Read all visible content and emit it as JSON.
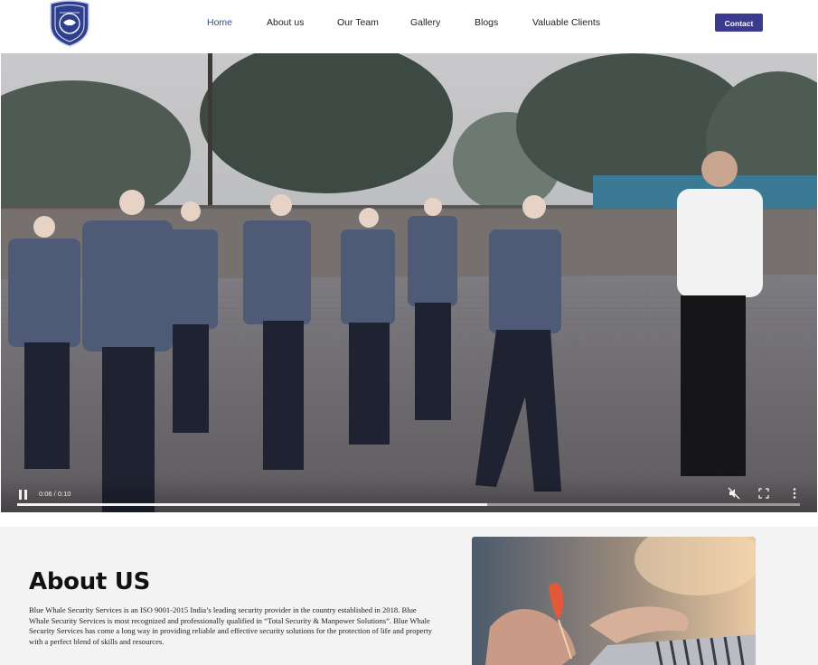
{
  "nav": {
    "logo_icon": "shield-badge-icon",
    "links": [
      {
        "label": "Home",
        "active": true
      },
      {
        "label": "About us",
        "active": false
      },
      {
        "label": "Our Team",
        "active": false
      },
      {
        "label": "Gallery",
        "active": false
      },
      {
        "label": "Blogs",
        "active": false
      },
      {
        "label": "Valuable Clients",
        "active": false
      }
    ],
    "contact_label": "Contact",
    "accent_color": "#3a3a8f"
  },
  "hero_video": {
    "time_display": "0:06 / 0:10",
    "progress": 0.6,
    "controls": [
      "pause-icon",
      "mute-icon",
      "fullscreen-icon",
      "more-options-icon"
    ]
  },
  "about": {
    "title": "About US",
    "body": "Blue Whale Security Services is an ISO 9001-2015 India’s leading security provider in the country established in 2018. Blue Whale Security Services is most recognized and professionally qualified in “Total Security & Manpower Solutions”. Blue Whale Security Services has come a long way in providing reliable and effective security solutions for the protection of life and property with a perfect blend of skills and resources."
  }
}
